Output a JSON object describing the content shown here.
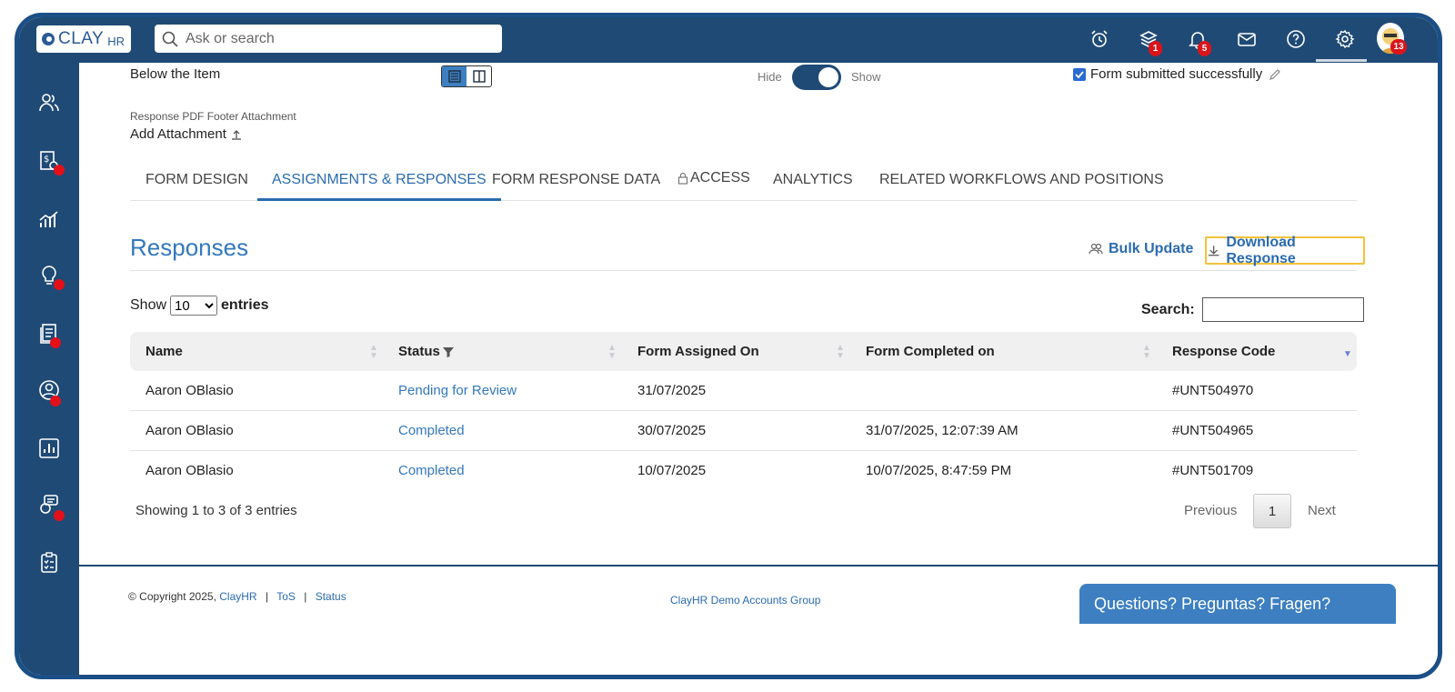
{
  "brand": {
    "logo_main": "CLAY",
    "logo_sub": "HR"
  },
  "search": {
    "placeholder": "Ask or search"
  },
  "topbar": {
    "layers_badge": "1",
    "bell_badge": "5",
    "avatar_badge": "13"
  },
  "settings_row": {
    "below_label": "Below the Item",
    "hide_label": "Hide",
    "show_label": "Show",
    "form_submitted": "Form submitted successfully",
    "pdf_footer_label": "Response PDF Footer Attachment",
    "add_attachment": "Add Attachment"
  },
  "tabs": [
    {
      "label": "FORM DESIGN"
    },
    {
      "label": "ASSIGNMENTS & RESPONSES"
    },
    {
      "label": "FORM RESPONSE DATA"
    },
    {
      "label": "ACCESS"
    },
    {
      "label": "ANALYTICS"
    },
    {
      "label": "RELATED WORKFLOWS AND POSITIONS"
    }
  ],
  "responses": {
    "title": "Responses",
    "bulk_update": "Bulk Update",
    "download": "Download Response",
    "show": "Show",
    "entries_count": "10",
    "entries": "entries",
    "search_label": "Search:"
  },
  "table": {
    "headers": [
      "Name",
      "Status",
      "Form Assigned On",
      "Form Completed on",
      "Response Code"
    ],
    "rows": [
      {
        "name": "Aaron OBlasio",
        "status": "Pending for Review",
        "assigned": "31/07/2025",
        "completed": "",
        "code": "#UNT504970"
      },
      {
        "name": "Aaron OBlasio",
        "status": "Completed",
        "assigned": "30/07/2025",
        "completed": "31/07/2025, 12:07:39 AM",
        "code": "#UNT504965"
      },
      {
        "name": "Aaron OBlasio",
        "status": "Completed",
        "assigned": "10/07/2025",
        "completed": "10/07/2025, 8:47:59 PM",
        "code": "#UNT501709"
      }
    ],
    "info": "Showing 1 to 3 of 3 entries",
    "previous": "Previous",
    "page": "1",
    "next": "Next"
  },
  "footer": {
    "copyright": "© Copyright 2025,",
    "brand_link": "ClayHR",
    "tos": "ToS",
    "status": "Status",
    "group": "ClayHR Demo Accounts Group",
    "questions": "Questions? Preguntas? Fragen?"
  },
  "colors": {
    "primary": "#1f4a75",
    "link": "#2a6bb0",
    "badge": "#d9151b",
    "highlight": "#f2c23b"
  }
}
